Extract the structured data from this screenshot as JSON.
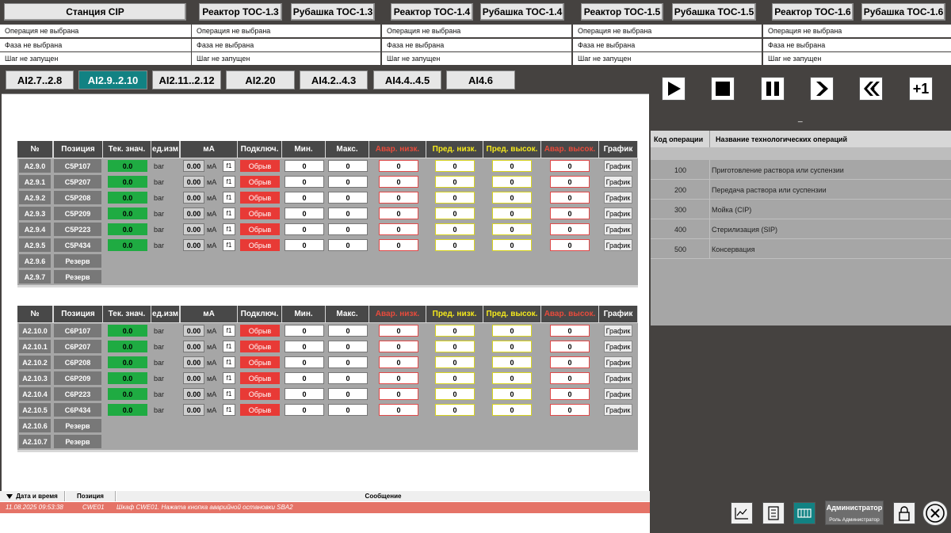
{
  "stations": [
    {
      "buttons": [
        "Станция CIP"
      ],
      "operation": "Операция не выбрана",
      "phase": "Фаза не выбрана",
      "step": "Шаг не запущен"
    },
    {
      "buttons": [
        "Реактор ТОС-1.3",
        "Рубашка ТОС-1.3"
      ],
      "operation": "Операция не выбрана",
      "phase": "Фаза не выбрана",
      "step": "Шаг не запущен"
    },
    {
      "buttons": [
        "Реактор ТОС-1.4",
        "Рубашка ТОС-1.4"
      ],
      "operation": "Операция не выбрана",
      "phase": "Фаза не выбрана",
      "step": "Шаг не запущен"
    },
    {
      "buttons": [
        "Реактор ТОС-1.5",
        "Рубашка ТОС-1.5"
      ],
      "operation": "Операция не выбрана",
      "phase": "Фаза не выбрана",
      "step": "Шаг не запущен"
    },
    {
      "buttons": [
        "Реактор ТОС-1.6",
        "Рубашка ТОС-1.6"
      ],
      "operation": "Операция не выбрана",
      "phase": "Фаза не выбрана",
      "step": "Шаг не запущен"
    }
  ],
  "tabs": [
    "AI2.7..2.8",
    "AI2.9..2.10",
    "AI2.11..2.12",
    "AI2.20",
    "AI4.2..4.3",
    "AI4.4..4.5",
    "AI4.6"
  ],
  "active_tab": 1,
  "columns": [
    "№",
    "Позиция",
    "Тек. знач.",
    "ед.изм",
    "мА",
    "Подключ.",
    "Мин.",
    "Макс.",
    "Авар. низк.",
    "Пред. низк.",
    "Пред. высок.",
    "Авар. высок.",
    "График"
  ],
  "colors": {
    "alarm_header": "#e84b3c",
    "warning_header": "#f4e81c",
    "active_tab": "#128283",
    "ok_value": "#1fab42",
    "disconnected": "#e83a36"
  },
  "sensor_group_1": {
    "rows": [
      {
        "id": "A2.9.0",
        "pos": "C5P107",
        "value": "0.0",
        "unit": "bar",
        "ma": "0.00",
        "ma_unit": "мА",
        "f": "f1",
        "status": "Обрыв",
        "min": "0",
        "max": "0",
        "alo": "0",
        "wlo": "0",
        "whi": "0",
        "ahi": "0",
        "graph": "График"
      },
      {
        "id": "A2.9.1",
        "pos": "C5P207",
        "value": "0.0",
        "unit": "bar",
        "ma": "0.00",
        "ma_unit": "мА",
        "f": "f1",
        "status": "Обрыв",
        "min": "0",
        "max": "0",
        "alo": "0",
        "wlo": "0",
        "whi": "0",
        "ahi": "0",
        "graph": "График"
      },
      {
        "id": "A2.9.2",
        "pos": "C5P208",
        "value": "0.0",
        "unit": "bar",
        "ma": "0.00",
        "ma_unit": "мА",
        "f": "f1",
        "status": "Обрыв",
        "min": "0",
        "max": "0",
        "alo": "0",
        "wlo": "0",
        "whi": "0",
        "ahi": "0",
        "graph": "График"
      },
      {
        "id": "A2.9.3",
        "pos": "C5P209",
        "value": "0.0",
        "unit": "bar",
        "ma": "0.00",
        "ma_unit": "мА",
        "f": "f1",
        "status": "Обрыв",
        "min": "0",
        "max": "0",
        "alo": "0",
        "wlo": "0",
        "whi": "0",
        "ahi": "0",
        "graph": "График"
      },
      {
        "id": "A2.9.4",
        "pos": "C5P223",
        "value": "0.0",
        "unit": "bar",
        "ma": "0.00",
        "ma_unit": "мА",
        "f": "f1",
        "status": "Обрыв",
        "min": "0",
        "max": "0",
        "alo": "0",
        "wlo": "0",
        "whi": "0",
        "ahi": "0",
        "graph": "График"
      },
      {
        "id": "A2.9.5",
        "pos": "C5P434",
        "value": "0.0",
        "unit": "bar",
        "ma": "0.00",
        "ma_unit": "мА",
        "f": "f1",
        "status": "Обрыв",
        "min": "0",
        "max": "0",
        "alo": "0",
        "wlo": "0",
        "whi": "0",
        "ahi": "0",
        "graph": "График"
      }
    ],
    "reserve": [
      {
        "id": "A2.9.6",
        "pos": "Резерв"
      },
      {
        "id": "A2.9.7",
        "pos": "Резерв"
      }
    ]
  },
  "sensor_group_2": {
    "rows": [
      {
        "id": "A2.10.0",
        "pos": "C6P107",
        "value": "0.0",
        "unit": "bar",
        "ma": "0.00",
        "ma_unit": "мА",
        "f": "f1",
        "status": "Обрыв",
        "min": "0",
        "max": "0",
        "alo": "0",
        "wlo": "0",
        "whi": "0",
        "ahi": "0",
        "graph": "График"
      },
      {
        "id": "A2.10.1",
        "pos": "C6P207",
        "value": "0.0",
        "unit": "bar",
        "ma": "0.00",
        "ma_unit": "мА",
        "f": "f1",
        "status": "Обрыв",
        "min": "0",
        "max": "0",
        "alo": "0",
        "wlo": "0",
        "whi": "0",
        "ahi": "0",
        "graph": "График"
      },
      {
        "id": "A2.10.2",
        "pos": "C6P208",
        "value": "0.0",
        "unit": "bar",
        "ma": "0.00",
        "ma_unit": "мА",
        "f": "f1",
        "status": "Обрыв",
        "min": "0",
        "max": "0",
        "alo": "0",
        "wlo": "0",
        "whi": "0",
        "ahi": "0",
        "graph": "График"
      },
      {
        "id": "A2.10.3",
        "pos": "C6P209",
        "value": "0.0",
        "unit": "bar",
        "ma": "0.00",
        "ma_unit": "мА",
        "f": "f1",
        "status": "Обрыв",
        "min": "0",
        "max": "0",
        "alo": "0",
        "wlo": "0",
        "whi": "0",
        "ahi": "0",
        "graph": "График"
      },
      {
        "id": "A2.10.4",
        "pos": "C6P223",
        "value": "0.0",
        "unit": "bar",
        "ma": "0.00",
        "ma_unit": "мА",
        "f": "f1",
        "status": "Обрыв",
        "min": "0",
        "max": "0",
        "alo": "0",
        "wlo": "0",
        "whi": "0",
        "ahi": "0",
        "graph": "График"
      },
      {
        "id": "A2.10.5",
        "pos": "C6P434",
        "value": "0.0",
        "unit": "bar",
        "ma": "0.00",
        "ma_unit": "мА",
        "f": "f1",
        "status": "Обрыв",
        "min": "0",
        "max": "0",
        "alo": "0",
        "wlo": "0",
        "whi": "0",
        "ahi": "0",
        "graph": "График"
      }
    ],
    "reserve": [
      {
        "id": "A2.10.6",
        "pos": "Резерв"
      },
      {
        "id": "A2.10.7",
        "pos": "Резерв"
      }
    ]
  },
  "controls": {
    "icons": [
      "play-icon",
      "stop-icon",
      "pause-icon",
      "next-step-icon",
      "rewind-icon",
      "plus-one-icon"
    ],
    "plus_one_label": "+1",
    "step_indicator": "_"
  },
  "operations": {
    "headers": [
      "Код операции",
      "Название технологических операций"
    ],
    "rows": [
      {
        "code": "100",
        "name": "Приготовление раствора или суспензии"
      },
      {
        "code": "200",
        "name": "Передача раствора или суспензии"
      },
      {
        "code": "300",
        "name": "Мойка (CIP)"
      },
      {
        "code": "400",
        "name": "Стерилизация (SIP)"
      },
      {
        "code": "500",
        "name": "Консервация"
      }
    ]
  },
  "alarms": {
    "headers": [
      "Дата и время",
      "Позиция",
      "Сообщение"
    ],
    "sort_icon": "sort-down-icon",
    "rows": [
      {
        "datetime": "11.08.2025 09:53:38",
        "position": "CWE01",
        "message": "Шкаф CWE01. Нажата кнопка аварийной остановки SBA2"
      }
    ]
  },
  "user": {
    "name": "Администратор",
    "role": "Роль Администратор"
  },
  "bottom_icons": [
    "trend-chart-icon",
    "report-icon",
    "module-icon",
    "user-lock-icon",
    "exit-icon"
  ]
}
